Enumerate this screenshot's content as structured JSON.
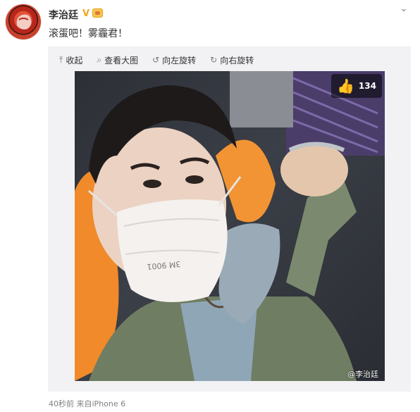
{
  "post": {
    "username": "李治廷",
    "verified_mark": "V",
    "text": "滚蛋吧！雾霾君！",
    "time": "40秒前",
    "source": "来自iPhone 6"
  },
  "toolbar": {
    "collapse": "收起",
    "view_large": "查看大图",
    "rotate_left": "向左旋转",
    "rotate_right": "向右旋转"
  },
  "photo": {
    "likes": "134",
    "watermark": "@李治廷",
    "mask_text": "3M 9001"
  },
  "icons": {
    "collapse": "arrow-up-icon",
    "view_large": "magnifier-icon",
    "rotate_left": "rotate-left-icon",
    "rotate_right": "rotate-right-icon",
    "like": "thumbs-up-icon",
    "menu": "chevron-down-icon"
  },
  "colors": {
    "card_bg": "#f2f2f5",
    "verified": "#f5a623",
    "meta_text": "#808080"
  }
}
